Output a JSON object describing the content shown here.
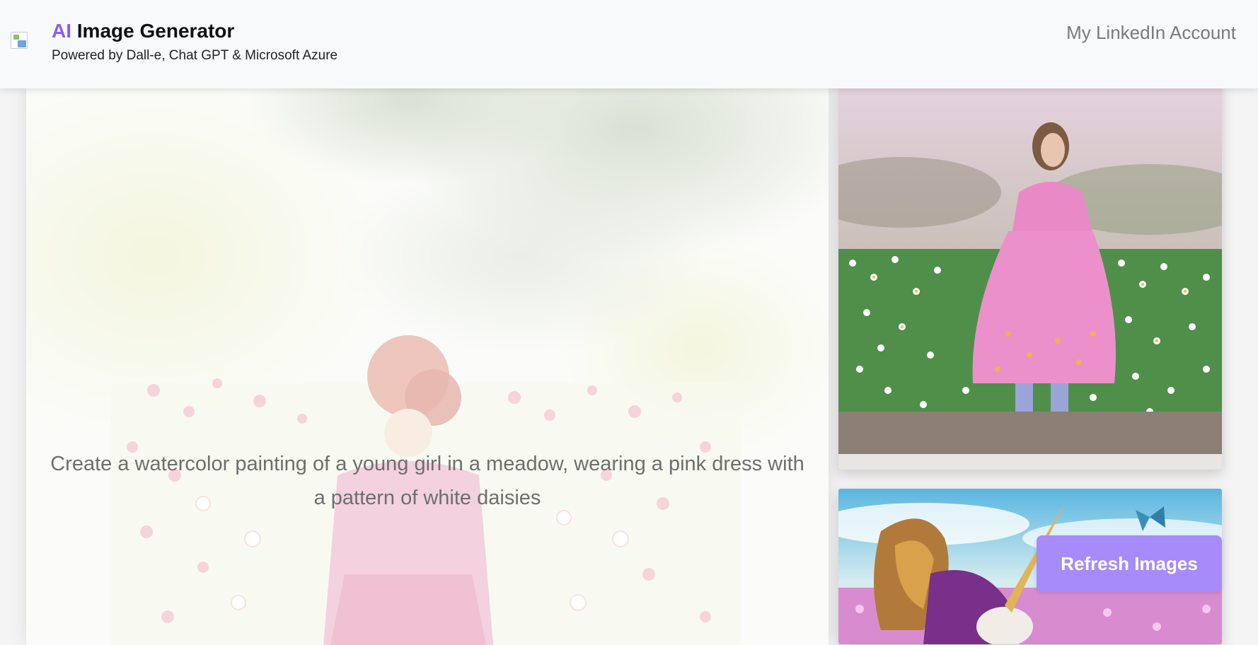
{
  "header": {
    "title_accent": "AI",
    "title_rest": " Image Generator",
    "subtitle": "Powered by Dall-e, Chat GPT & Microsoft Azure",
    "account_link": "My LinkedIn Account",
    "accent_color": "#8b5cf6"
  },
  "main": {
    "prompt": "Create a watercolor painting of a young girl in a meadow, wearing a pink dress with a pattern of white daisies"
  },
  "sidebar": {
    "thumbnails": [
      {
        "subject": "girl-in-pink-dress-daisy-field"
      },
      {
        "subject": "winged-unicorn-with-butterfly"
      }
    ]
  },
  "actions": {
    "refresh_label": "Refresh Images",
    "refresh_color": "#a78bfa"
  }
}
